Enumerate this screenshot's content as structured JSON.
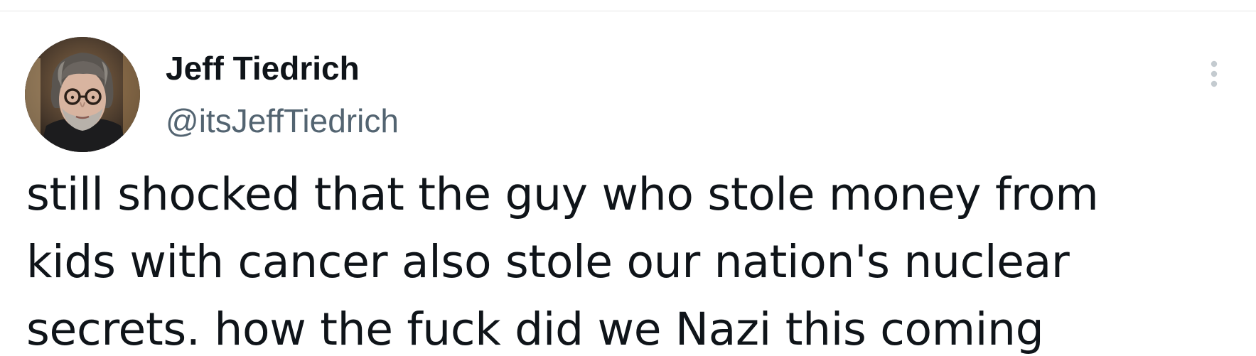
{
  "tweet": {
    "author": {
      "display_name": "Jeff Tiedrich",
      "handle": "@itsJeffTiedrich",
      "avatar_icon": "person-photo"
    },
    "more_icon": "more-vertical-dots-icon",
    "text_lines": [
      "still shocked that the guy who stole money from",
      "kids with cancer also stole our nation's nuclear",
      "secrets. how the fuck did we Nazi this coming"
    ]
  },
  "colors": {
    "text_primary": "#0f1419",
    "text_secondary": "#536471",
    "divider": "#e6e6e6",
    "background": "#ffffff"
  }
}
